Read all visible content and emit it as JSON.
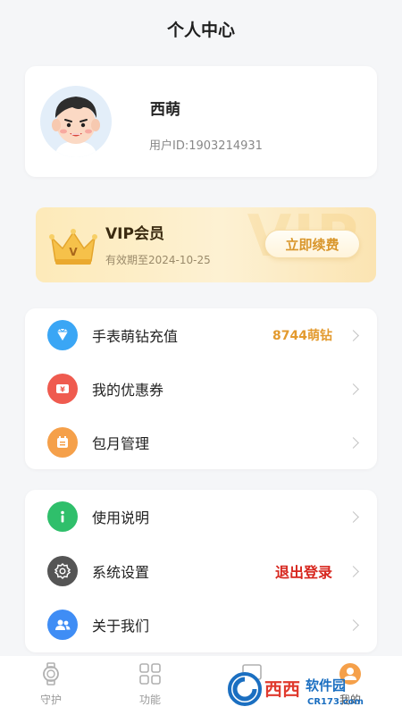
{
  "header": {
    "title": "个人中心"
  },
  "profile": {
    "name": "西萌",
    "user_id": "用户ID:1903214931"
  },
  "vip": {
    "title": "VIP会员",
    "expire": "有效期至2024-10-25",
    "renew_label": "立即续费",
    "watermark": "VIP",
    "crown_letter": "V"
  },
  "menu1": [
    {
      "label": "手表萌钻充值",
      "value": "8744萌钻",
      "icon": "diamond-icon",
      "color": "#3aa6f5"
    },
    {
      "label": "我的优惠券",
      "value": "",
      "icon": "coupon-icon",
      "color": "#ef5b4f"
    },
    {
      "label": "包月管理",
      "value": "",
      "icon": "calendar-icon",
      "color": "#f5a04a"
    }
  ],
  "menu2": [
    {
      "label": "使用说明",
      "value": "",
      "icon": "info-icon",
      "color": "#2fbf6b"
    },
    {
      "label": "系统设置",
      "value": "退出登录",
      "icon": "gear-icon",
      "color": "#555555"
    },
    {
      "label": "关于我们",
      "value": "",
      "icon": "users-icon",
      "color": "#3f8df5"
    }
  ],
  "colors": {
    "diamond_value": "#e39a2e",
    "logout": "#d7261e"
  },
  "tabs": [
    {
      "label": "守护",
      "icon": "watch-icon"
    },
    {
      "label": "功能",
      "icon": "grid-icon"
    },
    {
      "label": "",
      "icon": "message-icon"
    },
    {
      "label": "我的",
      "icon": "profile-icon"
    }
  ],
  "watermark": {
    "brand": "西西",
    "brand2": "软件园",
    "url": "CR173.com"
  }
}
